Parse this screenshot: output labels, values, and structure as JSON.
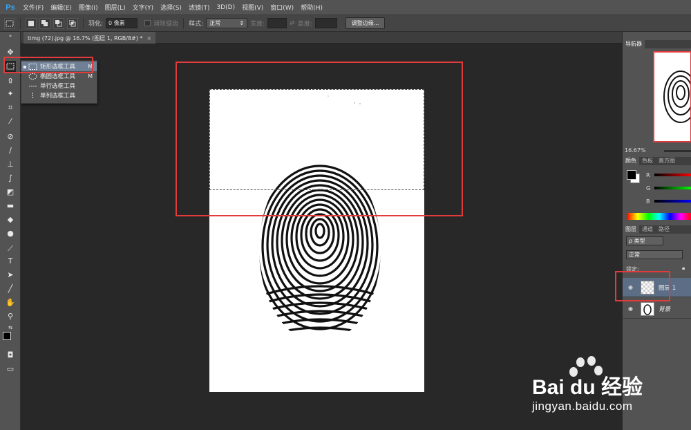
{
  "app": {
    "logo": "Ps"
  },
  "menu": [
    "文件(F)",
    "编辑(E)",
    "图像(I)",
    "图层(L)",
    "文字(Y)",
    "选择(S)",
    "滤镜(T)",
    "3D(D)",
    "视图(V)",
    "窗口(W)",
    "帮助(H)"
  ],
  "options": {
    "feather_label": "羽化:",
    "feather_value": "0 像素",
    "antialias_label": "消除锯齿",
    "style_label": "样式:",
    "style_value": "正常",
    "width_label": "宽度:",
    "height_label": "高度:",
    "refine_button": "调整边缘..."
  },
  "document_tab": {
    "title": "timg (72).jpg @ 16.7% (图层 1, RGB/8#) *",
    "close": "×"
  },
  "flyout": {
    "items": [
      {
        "label": "矩形选框工具",
        "key": "M",
        "selected": true
      },
      {
        "label": "椭圆选框工具",
        "key": "M",
        "selected": false
      },
      {
        "label": "单行选框工具",
        "key": "",
        "selected": false
      },
      {
        "label": "单列选框工具",
        "key": "",
        "selected": false
      }
    ]
  },
  "navigator": {
    "tab": "导航器",
    "zoom": "16.67%"
  },
  "color_panel": {
    "tabs": [
      "颜色",
      "色板",
      "直方图"
    ],
    "channels": [
      "R",
      "G",
      "B"
    ]
  },
  "layers_panel": {
    "tabs": [
      "图层",
      "通道",
      "路径"
    ],
    "filter": "ρ 类型",
    "blend_mode": "正常",
    "lock_label": "锁定:",
    "layers": [
      {
        "name": "图层 1",
        "selected": true
      },
      {
        "name": "背景",
        "selected": false
      }
    ]
  },
  "watermark": {
    "brand": "Bai du 经验",
    "url": "jingyan.baidu.com"
  },
  "colors": {
    "highlight": "#e23b3b",
    "canvas_bg": "#282828",
    "panel_bg": "#535353"
  }
}
